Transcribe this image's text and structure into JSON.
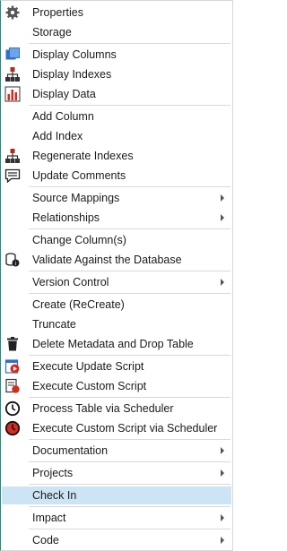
{
  "menu": {
    "properties": "Properties",
    "storage": "Storage",
    "display_columns": "Display Columns",
    "display_indexes": "Display Indexes",
    "display_data": "Display Data",
    "add_column": "Add Column",
    "add_index": "Add Index",
    "regenerate_indexes": "Regenerate Indexes",
    "update_comments": "Update Comments",
    "source_mappings": "Source Mappings",
    "relationships": "Relationships",
    "change_columns": "Change Column(s)",
    "validate_against_db": "Validate Against the Database",
    "version_control": "Version Control",
    "create_recreate": "Create (ReCreate)",
    "truncate": "Truncate",
    "delete_metadata_drop_table": "Delete Metadata and Drop Table",
    "execute_update_script": "Execute Update Script",
    "execute_custom_script": "Execute Custom Script",
    "process_table_via_scheduler": "Process Table via Scheduler",
    "execute_custom_script_via_scheduler": "Execute Custom Script via Scheduler",
    "documentation": "Documentation",
    "projects": "Projects",
    "check_in": "Check In",
    "impact": "Impact",
    "code": "Code"
  },
  "icons": {
    "properties": "gear-icon",
    "display_columns": "columns-icon",
    "display_indexes": "hierarchy-icon",
    "display_data": "bar-chart-icon",
    "regenerate_indexes": "hierarchy-icon",
    "update_comments": "comment-icon",
    "validate_against_db": "database-check-icon",
    "delete_metadata_drop_table": "trash-icon",
    "execute_update_script": "script-run-icon",
    "execute_custom_script": "script-custom-icon",
    "process_table_via_scheduler": "clock-icon",
    "execute_custom_script_via_scheduler": "clock-red-icon"
  },
  "colors": {
    "highlight": "#cce4f4",
    "accent_red": "#d62b1f",
    "accent_blue": "#2e6fd0"
  }
}
